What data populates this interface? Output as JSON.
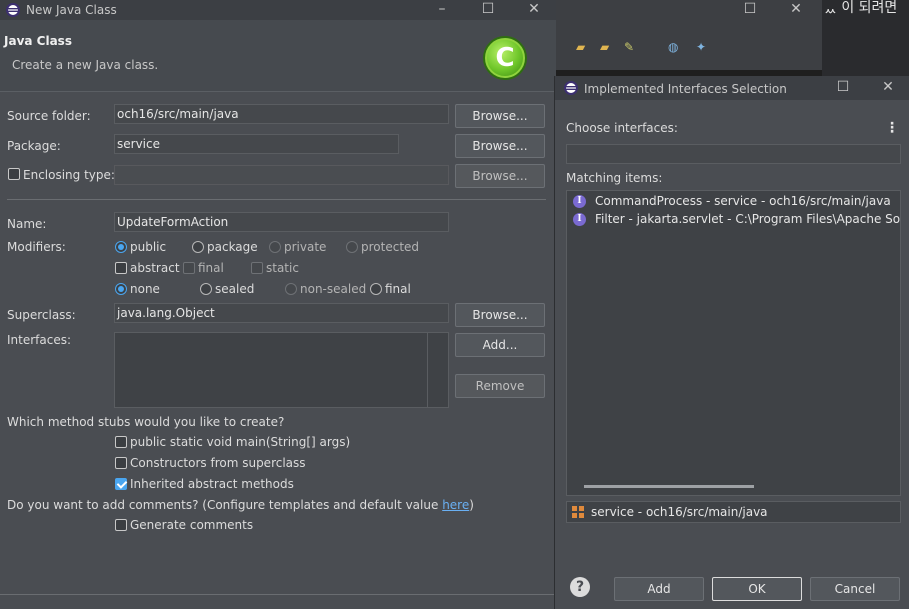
{
  "main_dialog": {
    "title": "New Java Class",
    "header_title": "Java Class",
    "header_subtitle": "Create a new Java class.",
    "badge_letter": "C",
    "source_folder": {
      "label": "Source folder:",
      "value": "och16/src/main/java",
      "button": "Browse..."
    },
    "package": {
      "label": "Package:",
      "value": "service",
      "button": "Browse..."
    },
    "enclosing_type": {
      "label": "Enclosing type:",
      "value": "",
      "button": "Browse..."
    },
    "name": {
      "label": "Name:",
      "value": "UpdateFormAction"
    },
    "modifiers": {
      "label": "Modifiers:",
      "access": [
        "public",
        "package",
        "private",
        "protected"
      ],
      "flags": [
        "abstract",
        "final",
        "static"
      ],
      "sealing": [
        "none",
        "sealed",
        "non-sealed",
        "final"
      ]
    },
    "superclass": {
      "label": "Superclass:",
      "value": "java.lang.Object",
      "button": "Browse..."
    },
    "interfaces": {
      "label": "Interfaces:",
      "add_button": "Add...",
      "remove_button": "Remove"
    },
    "stubs_question": "Which method stubs would you like to create?",
    "stubs": [
      {
        "label": "public static void main(String[] args)",
        "checked": false
      },
      {
        "label": "Constructors from superclass",
        "checked": false
      },
      {
        "label": "Inherited abstract methods",
        "checked": true
      }
    ],
    "comments_question_prefix": "Do you want to add comments? (Configure templates and default value ",
    "comments_link": "here",
    "comments_question_suffix": ")",
    "generate_comments": {
      "label": "Generate comments",
      "checked": false
    }
  },
  "background_window": {
    "korean_text": "ᆻ 이 되려면"
  },
  "selection_dialog": {
    "title": "Implemented Interfaces Selection",
    "choose_label": "Choose interfaces:",
    "filter_value": "",
    "matching_label": "Matching items:",
    "items": [
      {
        "icon": "interface-icon",
        "text": "CommandProcess - service - och16/src/main/java"
      },
      {
        "icon": "interface-icon",
        "text": "Filter - jakarta.servlet - C:\\Program Files\\Apache Softwa"
      }
    ],
    "selected_package": "service - och16/src/main/java",
    "buttons": {
      "add": "Add",
      "ok": "OK",
      "cancel": "Cancel"
    }
  },
  "colors": {
    "accent": "#4aa6f0",
    "badge": "#6fc62a",
    "interface_icon": "#7a6ad1"
  }
}
